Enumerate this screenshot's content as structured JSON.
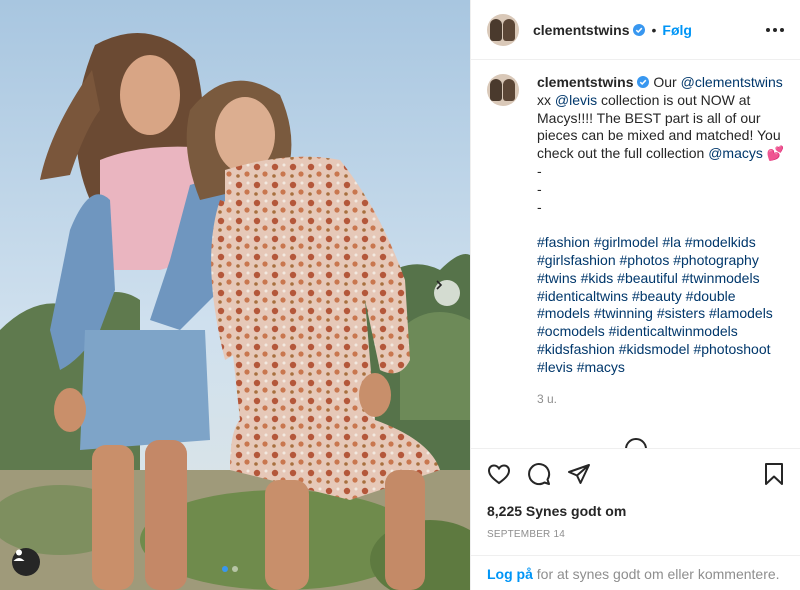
{
  "post": {
    "username": "clementstwins",
    "follow_label": "Følg",
    "separator": "•",
    "caption": {
      "username": "clementstwins",
      "text_1": " Our ",
      "mention_1": "@clementstwins",
      "text_2": " xx ",
      "mention_2": "@levis",
      "text_3": " collection is out NOW at Macys!!!! The BEST part is all of our pieces can be mixed and matched! You check out the full collection ",
      "mention_3": "@macys",
      "emoji": "💕",
      "dash_lines": [
        "-",
        "-",
        "-"
      ],
      "hashtags": [
        "#fashion",
        "#girlmodel",
        "#la",
        "#modelkids",
        "#girlsfashion",
        "#photos",
        "#photography",
        "#twins",
        "#kids",
        "#beautiful",
        "#twinmodels",
        "#identicaltwins",
        "#beauty",
        "#double",
        "#models",
        "#twinning",
        "#sisters",
        "#lamodels",
        "#ocmodels",
        "#identicaltwinmodels",
        "#kidsfashion",
        "#kidsmodel",
        "#photoshoot",
        "#levis",
        "#macys"
      ],
      "time_ago": "3 u."
    },
    "likes": "8,225 Synes godt om",
    "date": "SEPTEMBER 14",
    "login_link": "Log på",
    "login_text": " for at synes godt om eller kommentere."
  },
  "photo": {
    "carousel_total": 2,
    "carousel_active": 1
  },
  "icons": {
    "verified": "verified-badge-icon",
    "more": "more-options-icon",
    "next": "chevron-right-icon",
    "tag": "user-tag-icon",
    "like": "heart-icon",
    "comment": "comment-icon",
    "share": "paper-plane-icon",
    "save": "bookmark-icon"
  },
  "colors": {
    "link": "#00376b",
    "follow": "#0095f6",
    "verified": "#3897f0",
    "muted": "#8e8e8e"
  }
}
